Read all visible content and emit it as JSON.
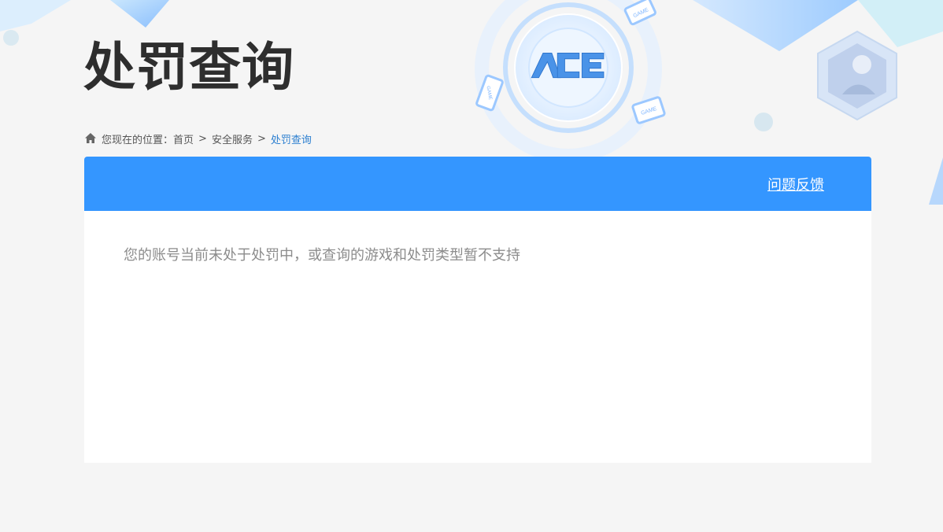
{
  "header": {
    "title": "处罚查询",
    "logo_text": "ACE",
    "badge_text": "GAME"
  },
  "breadcrumb": {
    "prefix": "您现在的位置：",
    "items": [
      "首页",
      "安全服务",
      "处罚查询"
    ],
    "separator": ">"
  },
  "panel": {
    "feedback_label": "问题反馈",
    "message": "您的账号当前未处于处罚中，或查询的游戏和处罚类型暂不支持"
  },
  "colors": {
    "accent": "#3496ff",
    "breadcrumb_current": "#2c7fd0",
    "title": "#2e2e2e",
    "message": "#8c8c8c"
  },
  "icons": {
    "home": "home-icon",
    "logo": "ace-logo-icon",
    "game": "gamepad-icon"
  }
}
